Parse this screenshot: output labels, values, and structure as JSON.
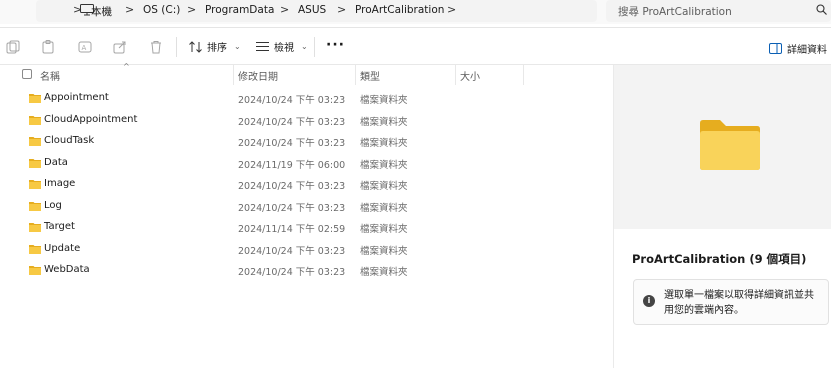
{
  "address": {
    "crumbs": [
      "本機",
      "OS (C:)",
      "ProgramData",
      "ASUS",
      "ProArtCalibration"
    ],
    "separator": ">"
  },
  "search": {
    "placeholder": "搜尋 ProArtCalibration"
  },
  "toolbar": {
    "sort_label": "排序",
    "view_label": "檢視",
    "more_label": "···",
    "details_label": "詳細資料"
  },
  "columns": {
    "name": "名稱",
    "date": "修改日期",
    "type": "類型",
    "size": "大小"
  },
  "files": [
    {
      "name": "Appointment",
      "date": "2024/10/24 下午 03:23",
      "type": "檔案資料夾"
    },
    {
      "name": "CloudAppointment",
      "date": "2024/10/24 下午 03:23",
      "type": "檔案資料夾"
    },
    {
      "name": "CloudTask",
      "date": "2024/10/24 下午 03:23",
      "type": "檔案資料夾"
    },
    {
      "name": "Data",
      "date": "2024/11/19 下午 06:00",
      "type": "檔案資料夾"
    },
    {
      "name": "Image",
      "date": "2024/10/24 下午 03:23",
      "type": "檔案資料夾"
    },
    {
      "name": "Log",
      "date": "2024/10/24 下午 03:23",
      "type": "檔案資料夾"
    },
    {
      "name": "Target",
      "date": "2024/11/14 下午 02:59",
      "type": "檔案資料夾"
    },
    {
      "name": "Update",
      "date": "2024/10/24 下午 03:23",
      "type": "檔案資料夾"
    },
    {
      "name": "WebData",
      "date": "2024/10/24 下午 03:23",
      "type": "檔案資料夾"
    }
  ],
  "details_pane": {
    "title": "ProArtCalibration (9 個項目)",
    "info": "選取單一檔案以取得詳細資訊並共用您的雲端內容。"
  },
  "colors": {
    "folder": "#f7c944",
    "folder_dark": "#e6ad1f"
  }
}
